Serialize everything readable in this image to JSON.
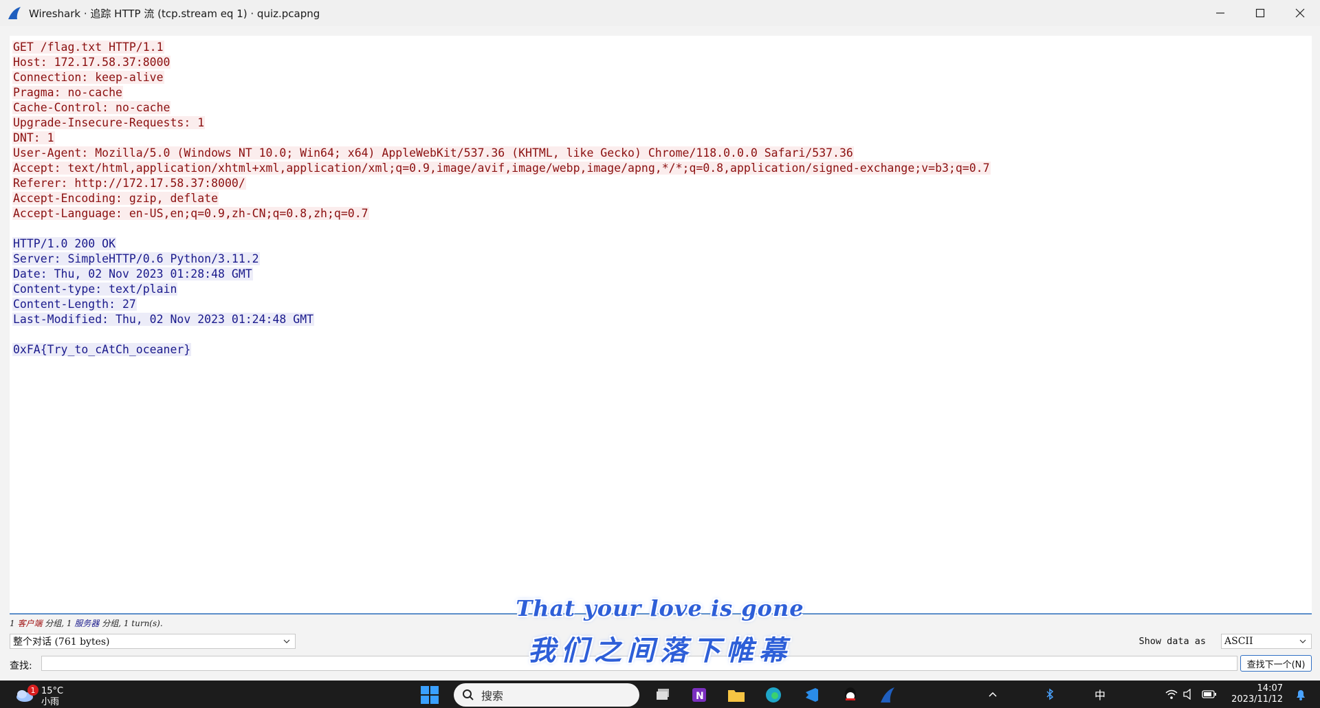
{
  "window": {
    "title": "Wireshark · 追踪 HTTP 流 (tcp.stream eq 1) · quiz.pcapng"
  },
  "stream": {
    "client_lines": [
      "GET /flag.txt HTTP/1.1",
      "Host: 172.17.58.37:8000",
      "Connection: keep-alive",
      "Pragma: no-cache",
      "Cache-Control: no-cache",
      "Upgrade-Insecure-Requests: 1",
      "DNT: 1",
      "User-Agent: Mozilla/5.0 (Windows NT 10.0; Win64; x64) AppleWebKit/537.36 (KHTML, like Gecko) Chrome/118.0.0.0 Safari/537.36",
      "Accept: text/html,application/xhtml+xml,application/xml;q=0.9,image/avif,image/webp,image/apng,*/*;q=0.8,application/signed-exchange;v=b3;q=0.7",
      "Referer: http://172.17.58.37:8000/",
      "Accept-Encoding: gzip, deflate",
      "Accept-Language: en-US,en;q=0.9,zh-CN;q=0.8,zh;q=0.7"
    ],
    "server_lines": [
      "HTTP/1.0 200 OK",
      "Server: SimpleHTTP/0.6 Python/3.11.2",
      "Date: Thu, 02 Nov 2023 01:28:48 GMT",
      "Content-type: text/plain",
      "Content-Length: 27",
      "Last-Modified: Thu, 02 Nov 2023 01:24:48 GMT"
    ],
    "body_line": "0xFA{Try_to_cAtCh_oceaner}",
    "colors": {
      "client_fg": "#8b1010",
      "client_bg": "#fbeded",
      "server_fg": "#1a1a8c",
      "server_bg": "#ececf8"
    }
  },
  "info": {
    "prefix_1": "1 ",
    "client_label": "客户端",
    "mid_1": " 分组, 1 ",
    "server_label": "服务器",
    "suffix": " 分组, 1 turn(s)."
  },
  "controls": {
    "conversation_select": "整个对话 (761 bytes)",
    "show_data_label": "Show data as",
    "show_data_select": "ASCII"
  },
  "find": {
    "label": "查找:",
    "value": "",
    "next_button": "查找下一个(N)"
  },
  "caption": {
    "english": "That your love is gone",
    "chinese": "我们之间落下帷幕"
  },
  "taskbar": {
    "weather_badge": "1",
    "temperature": "15°C",
    "weather_desc": "小雨",
    "search_placeholder": "搜索",
    "ime": "中",
    "time": "14:07",
    "date": "2023/11/12"
  }
}
